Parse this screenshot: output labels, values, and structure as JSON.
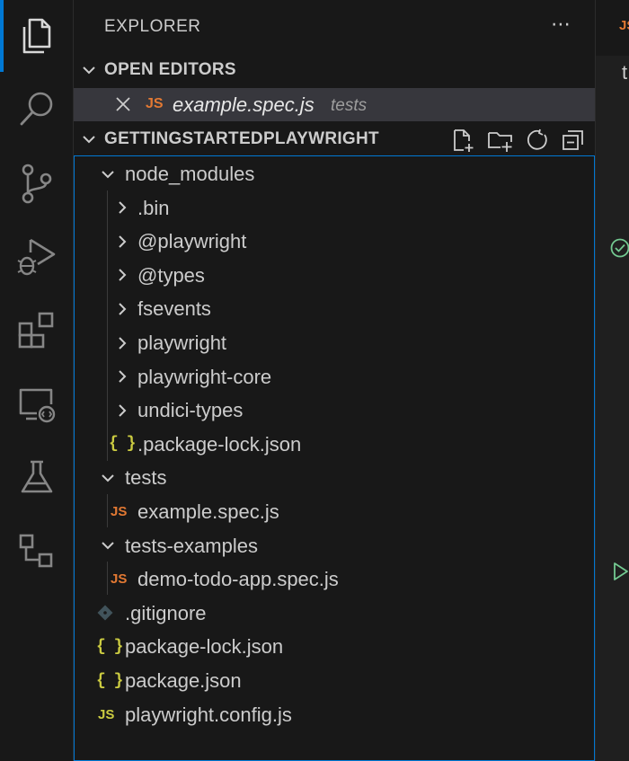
{
  "sidebar": {
    "title": "EXPLORER",
    "more_actions": "⋯"
  },
  "open_editors": {
    "label": "OPEN EDITORS",
    "items": [
      {
        "icon": "JS",
        "name": "example.spec.js",
        "description": "tests"
      }
    ]
  },
  "workspace": {
    "label": "GETTINGSTARTEDPLAYWRIGHT",
    "actions": [
      "new-file-icon",
      "new-folder-icon",
      "refresh-icon",
      "collapse-all-icon"
    ]
  },
  "tree": {
    "items": [
      {
        "name": "node_modules",
        "type": "folder",
        "expanded": true
      },
      {
        "name": ".bin",
        "type": "folder",
        "expanded": false
      },
      {
        "name": "@playwright",
        "type": "folder",
        "expanded": false
      },
      {
        "name": "@types",
        "type": "folder",
        "expanded": false
      },
      {
        "name": "fsevents",
        "type": "folder",
        "expanded": false
      },
      {
        "name": "playwright",
        "type": "folder",
        "expanded": false
      },
      {
        "name": "playwright-core",
        "type": "folder",
        "expanded": false
      },
      {
        "name": "undici-types",
        "type": "folder",
        "expanded": false
      },
      {
        "name": ".package-lock.json",
        "type": "json",
        "icon": "{ }"
      },
      {
        "name": "tests",
        "type": "folder",
        "expanded": true
      },
      {
        "name": "example.spec.js",
        "type": "js",
        "icon": "JS"
      },
      {
        "name": "tests-examples",
        "type": "folder",
        "expanded": true
      },
      {
        "name": "demo-todo-app.spec.js",
        "type": "js",
        "icon": "JS"
      },
      {
        "name": ".gitignore",
        "type": "git"
      },
      {
        "name": "package-lock.json",
        "type": "json",
        "icon": "{ }"
      },
      {
        "name": "package.json",
        "type": "json",
        "icon": "{ }"
      },
      {
        "name": "playwright.config.js",
        "type": "jsconfig",
        "icon": "JS"
      }
    ]
  },
  "editor": {
    "tab_icon": "JS",
    "visible_char": "t"
  },
  "colors": {
    "accent": "#0078d4",
    "js_orange": "#e37933",
    "json_yellow": "#cbcb41",
    "pass_green": "#73c991"
  }
}
